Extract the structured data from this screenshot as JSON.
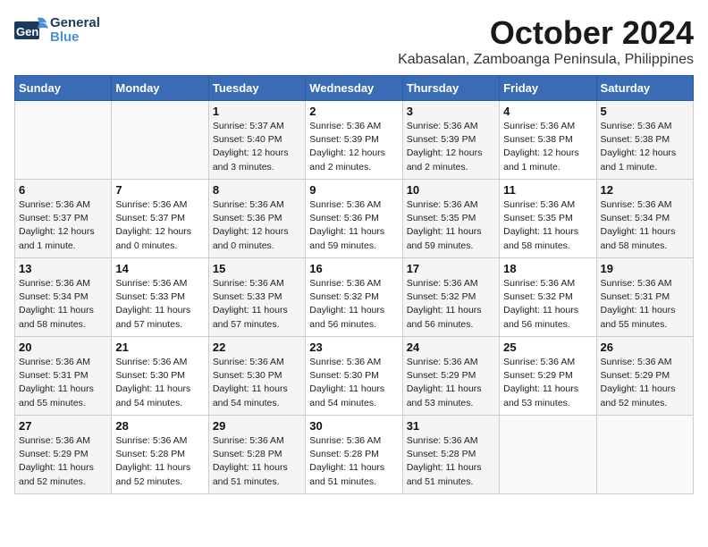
{
  "header": {
    "logo_line1": "General",
    "logo_line2": "Blue",
    "month": "October 2024",
    "location": "Kabasalan, Zamboanga Peninsula, Philippines"
  },
  "days_of_week": [
    "Sunday",
    "Monday",
    "Tuesday",
    "Wednesday",
    "Thursday",
    "Friday",
    "Saturday"
  ],
  "weeks": [
    [
      {
        "day": "",
        "info": ""
      },
      {
        "day": "",
        "info": ""
      },
      {
        "day": "1",
        "info": "Sunrise: 5:37 AM\nSunset: 5:40 PM\nDaylight: 12 hours\nand 3 minutes."
      },
      {
        "day": "2",
        "info": "Sunrise: 5:36 AM\nSunset: 5:39 PM\nDaylight: 12 hours\nand 2 minutes."
      },
      {
        "day": "3",
        "info": "Sunrise: 5:36 AM\nSunset: 5:39 PM\nDaylight: 12 hours\nand 2 minutes."
      },
      {
        "day": "4",
        "info": "Sunrise: 5:36 AM\nSunset: 5:38 PM\nDaylight: 12 hours\nand 1 minute."
      },
      {
        "day": "5",
        "info": "Sunrise: 5:36 AM\nSunset: 5:38 PM\nDaylight: 12 hours\nand 1 minute."
      }
    ],
    [
      {
        "day": "6",
        "info": "Sunrise: 5:36 AM\nSunset: 5:37 PM\nDaylight: 12 hours\nand 1 minute."
      },
      {
        "day": "7",
        "info": "Sunrise: 5:36 AM\nSunset: 5:37 PM\nDaylight: 12 hours\nand 0 minutes."
      },
      {
        "day": "8",
        "info": "Sunrise: 5:36 AM\nSunset: 5:36 PM\nDaylight: 12 hours\nand 0 minutes."
      },
      {
        "day": "9",
        "info": "Sunrise: 5:36 AM\nSunset: 5:36 PM\nDaylight: 11 hours\nand 59 minutes."
      },
      {
        "day": "10",
        "info": "Sunrise: 5:36 AM\nSunset: 5:35 PM\nDaylight: 11 hours\nand 59 minutes."
      },
      {
        "day": "11",
        "info": "Sunrise: 5:36 AM\nSunset: 5:35 PM\nDaylight: 11 hours\nand 58 minutes."
      },
      {
        "day": "12",
        "info": "Sunrise: 5:36 AM\nSunset: 5:34 PM\nDaylight: 11 hours\nand 58 minutes."
      }
    ],
    [
      {
        "day": "13",
        "info": "Sunrise: 5:36 AM\nSunset: 5:34 PM\nDaylight: 11 hours\nand 58 minutes."
      },
      {
        "day": "14",
        "info": "Sunrise: 5:36 AM\nSunset: 5:33 PM\nDaylight: 11 hours\nand 57 minutes."
      },
      {
        "day": "15",
        "info": "Sunrise: 5:36 AM\nSunset: 5:33 PM\nDaylight: 11 hours\nand 57 minutes."
      },
      {
        "day": "16",
        "info": "Sunrise: 5:36 AM\nSunset: 5:32 PM\nDaylight: 11 hours\nand 56 minutes."
      },
      {
        "day": "17",
        "info": "Sunrise: 5:36 AM\nSunset: 5:32 PM\nDaylight: 11 hours\nand 56 minutes."
      },
      {
        "day": "18",
        "info": "Sunrise: 5:36 AM\nSunset: 5:32 PM\nDaylight: 11 hours\nand 56 minutes."
      },
      {
        "day": "19",
        "info": "Sunrise: 5:36 AM\nSunset: 5:31 PM\nDaylight: 11 hours\nand 55 minutes."
      }
    ],
    [
      {
        "day": "20",
        "info": "Sunrise: 5:36 AM\nSunset: 5:31 PM\nDaylight: 11 hours\nand 55 minutes."
      },
      {
        "day": "21",
        "info": "Sunrise: 5:36 AM\nSunset: 5:30 PM\nDaylight: 11 hours\nand 54 minutes."
      },
      {
        "day": "22",
        "info": "Sunrise: 5:36 AM\nSunset: 5:30 PM\nDaylight: 11 hours\nand 54 minutes."
      },
      {
        "day": "23",
        "info": "Sunrise: 5:36 AM\nSunset: 5:30 PM\nDaylight: 11 hours\nand 54 minutes."
      },
      {
        "day": "24",
        "info": "Sunrise: 5:36 AM\nSunset: 5:29 PM\nDaylight: 11 hours\nand 53 minutes."
      },
      {
        "day": "25",
        "info": "Sunrise: 5:36 AM\nSunset: 5:29 PM\nDaylight: 11 hours\nand 53 minutes."
      },
      {
        "day": "26",
        "info": "Sunrise: 5:36 AM\nSunset: 5:29 PM\nDaylight: 11 hours\nand 52 minutes."
      }
    ],
    [
      {
        "day": "27",
        "info": "Sunrise: 5:36 AM\nSunset: 5:29 PM\nDaylight: 11 hours\nand 52 minutes."
      },
      {
        "day": "28",
        "info": "Sunrise: 5:36 AM\nSunset: 5:28 PM\nDaylight: 11 hours\nand 52 minutes."
      },
      {
        "day": "29",
        "info": "Sunrise: 5:36 AM\nSunset: 5:28 PM\nDaylight: 11 hours\nand 51 minutes."
      },
      {
        "day": "30",
        "info": "Sunrise: 5:36 AM\nSunset: 5:28 PM\nDaylight: 11 hours\nand 51 minutes."
      },
      {
        "day": "31",
        "info": "Sunrise: 5:36 AM\nSunset: 5:28 PM\nDaylight: 11 hours\nand 51 minutes."
      },
      {
        "day": "",
        "info": ""
      },
      {
        "day": "",
        "info": ""
      }
    ]
  ]
}
